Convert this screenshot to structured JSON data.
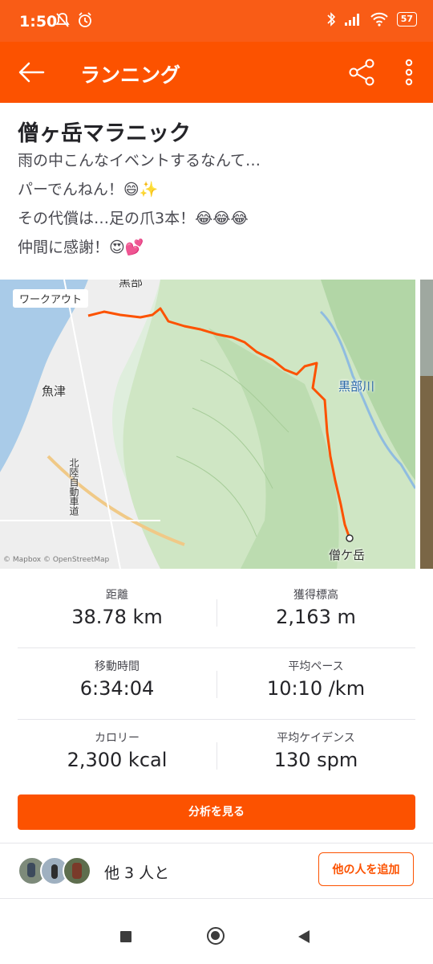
{
  "status_bar": {
    "time": "1:50",
    "battery": "57"
  },
  "app_bar": {
    "title": "ランニング"
  },
  "activity": {
    "title": "僧ヶ岳マラニック",
    "description_lines": [
      "雨の中こんなイベントするなんて…",
      "パーでんねん！😄✨",
      "その代償は…足の爪3本！😂😂😂",
      "仲間に感謝！😍💕"
    ]
  },
  "map": {
    "badge": "ワークアウト",
    "labels": {
      "top": "黒部",
      "left": "魚津",
      "river": "黒部川",
      "peak": "僧ケ岳",
      "road": "北陸自動車道"
    },
    "attribution": "© Mapbox © OpenStreetMap",
    "route_color": "#fc5200"
  },
  "stats": [
    [
      {
        "label": "距離",
        "value": "38.78 km"
      },
      {
        "label": "獲得標高",
        "value": "2,163 m"
      }
    ],
    [
      {
        "label": "移動時間",
        "value": "6:34:04"
      },
      {
        "label": "平均ペース",
        "value": "10:10 /km"
      }
    ],
    [
      {
        "label": "カロリー",
        "value": "2,300 kcal"
      },
      {
        "label": "平均ケイデンス",
        "value": "130 spm"
      }
    ]
  ],
  "analyze_button": "分析を見る",
  "with_others": {
    "text": "他 3 人と",
    "add_button": "他の人を追加"
  },
  "colors": {
    "brand": "#fc5200",
    "status_bar": "#f95c16"
  }
}
